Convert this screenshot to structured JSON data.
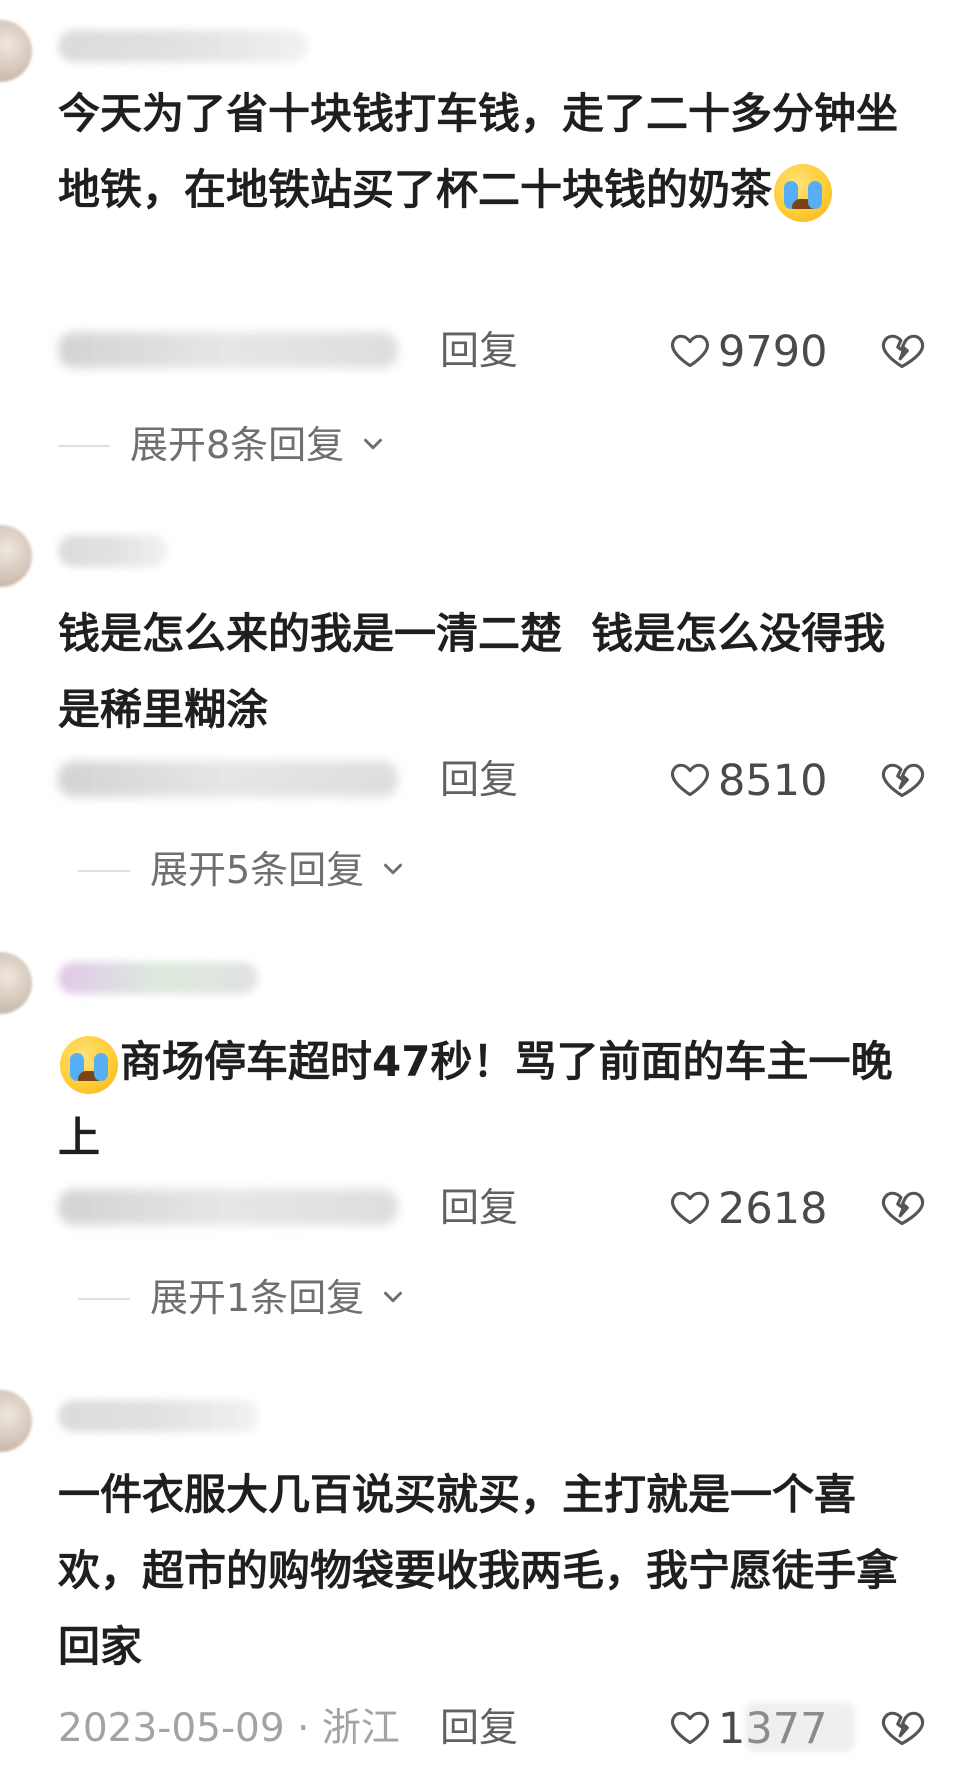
{
  "comments": [
    {
      "text_parts": [
        "今天为了省十块钱打车钱，走了二十多分钟坐地铁，在地铁站买了杯二十块钱的奶茶",
        ""
      ],
      "emoji_name": "crying-emoji",
      "reply_label": "回复",
      "likes": "9790",
      "expand_label": "展开8条回复"
    },
    {
      "text_parts": [
        "钱是怎么来的我是一清二楚  钱是怎么没得我是稀里糊涂"
      ],
      "reply_label": "回复",
      "likes": "8510",
      "expand_label": "展开5条回复"
    },
    {
      "text_parts": [
        "",
        "商场停车超时47秒！骂了前面的车主一晚上"
      ],
      "emoji_name": "crying-emoji",
      "reply_label": "回复",
      "likes": "2618",
      "expand_label": "展开1条回复"
    },
    {
      "text_parts": [
        "一件衣服大几百说买就买，主打就是一个喜欢，超市的购物袋要收我两毛，我宁愿徒手拿回家"
      ],
      "meta_text": "2023-05-09 · 浙江",
      "reply_label": "回复",
      "likes": "1377"
    }
  ],
  "colors": {
    "text_primary": "#1f1f1f",
    "text_secondary": "#a3a3a3",
    "reply": "#616161",
    "count": "#4a4a4a"
  }
}
